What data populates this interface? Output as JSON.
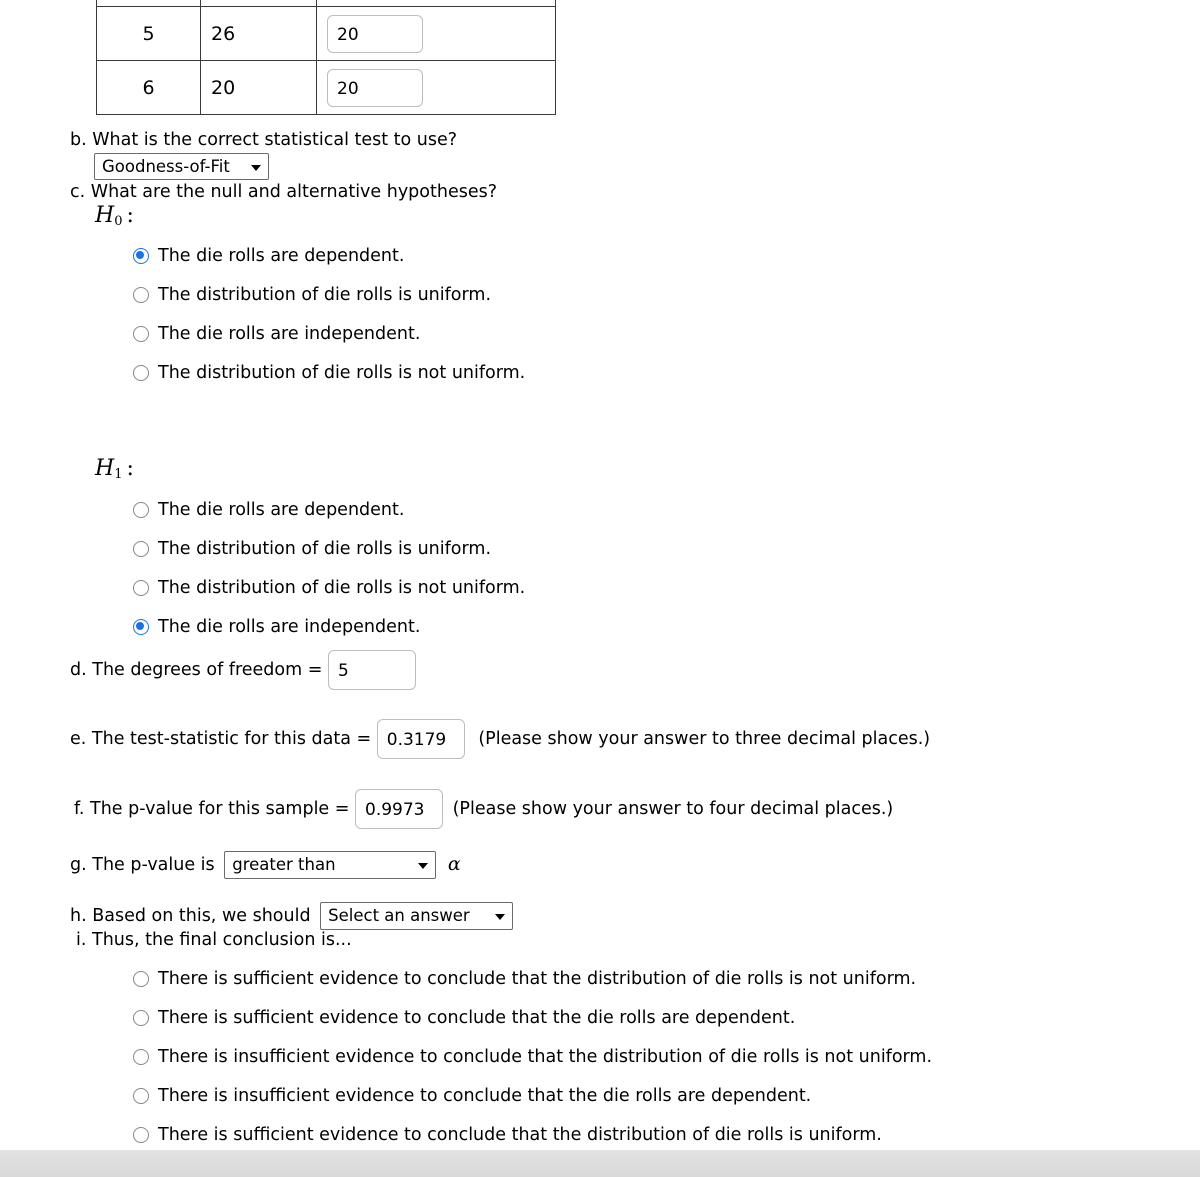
{
  "table": {
    "rows": [
      {
        "face": "",
        "observed": "",
        "expected": "",
        "partial": true
      },
      {
        "face": "5",
        "observed": "26",
        "expected": "20",
        "partial": false
      },
      {
        "face": "6",
        "observed": "20",
        "expected": "20",
        "partial": false
      }
    ]
  },
  "q_b": {
    "marker": "b.",
    "prompt": "What is the correct statistical test to use?",
    "select_value": "Goodness-of-Fit"
  },
  "q_c": {
    "marker": "c.",
    "prompt": "What are the null and alternative hypotheses?",
    "h0_label": "H",
    "h0_sub": "0",
    "h1_label": "H",
    "h1_sub": "1",
    "colon": ":",
    "h0_options": [
      {
        "label": "The die rolls are dependent.",
        "selected": true
      },
      {
        "label": "The distribution of die rolls is uniform.",
        "selected": false
      },
      {
        "label": "The die rolls are independent.",
        "selected": false
      },
      {
        "label": "The distribution of die rolls is not uniform.",
        "selected": false
      }
    ],
    "h1_options": [
      {
        "label": "The die rolls are dependent.",
        "selected": false
      },
      {
        "label": "The distribution of die rolls is uniform.",
        "selected": false
      },
      {
        "label": "The distribution of die rolls is not uniform.",
        "selected": false
      },
      {
        "label": "The die rolls are independent.",
        "selected": true
      }
    ]
  },
  "q_d": {
    "marker": "d.",
    "prompt": "The degrees of freedom =",
    "value": "5"
  },
  "q_e": {
    "marker": "e.",
    "prompt": "The test-statistic for this data =",
    "value": "0.3179",
    "note": "(Please show your answer to three decimal places.)"
  },
  "q_f": {
    "marker": "f.",
    "prompt": "The p-value for this sample =",
    "value": "0.9973",
    "note": "(Please show your answer to four decimal places.)"
  },
  "q_g": {
    "marker": "g.",
    "prompt": "The p-value is",
    "select_value": "greater than",
    "suffix": "α"
  },
  "q_h": {
    "marker": "h.",
    "prompt": "Based on this, we should",
    "select_value": "Select an answer"
  },
  "q_i": {
    "marker": "i.",
    "prompt": "Thus, the final conclusion is...",
    "options": [
      {
        "label": "There is sufficient evidence to conclude that the distribution of die rolls is not uniform.",
        "selected": false
      },
      {
        "label": "There is sufficient evidence to conclude that the die rolls are dependent.",
        "selected": false
      },
      {
        "label": "There is insufficient evidence to conclude that the distribution of die rolls is not uniform.",
        "selected": false
      },
      {
        "label": "There is insufficient evidence to conclude that the die rolls are dependent.",
        "selected": false
      },
      {
        "label": "There is sufficient evidence to conclude that the distribution of die rolls is uniform.",
        "selected": false
      }
    ]
  },
  "colors": {
    "radio_selected": "#1b73e8",
    "table_border": "#3a3a3a",
    "input_border": "#bdbdbd"
  }
}
